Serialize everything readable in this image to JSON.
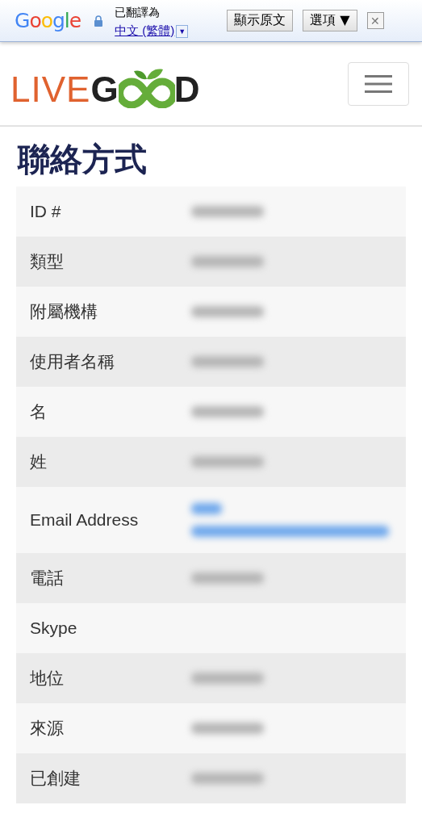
{
  "translate_bar": {
    "brand": "Google",
    "status": "已翻譯為",
    "language": "中文 (繁體)",
    "dropdown": "▼",
    "buttons": [
      "顯示原文",
      "選項 ▼"
    ],
    "close": "✕"
  },
  "header": {
    "logo": {
      "left": "LIVE",
      "middle": "G",
      "right": "D"
    }
  },
  "title": "聯絡方式",
  "rows": [
    {
      "label": "ID #",
      "kind": "redacted"
    },
    {
      "label": "類型",
      "kind": "redacted"
    },
    {
      "label": "附屬機構",
      "kind": "redacted"
    },
    {
      "label": "使用者名稱",
      "kind": "redacted"
    },
    {
      "label": "名",
      "kind": "redacted"
    },
    {
      "label": "姓",
      "kind": "redacted"
    },
    {
      "label": "Email Address",
      "kind": "link"
    },
    {
      "label": "電話",
      "kind": "redacted"
    },
    {
      "label": "Skype"
    },
    {
      "label": "地位",
      "kind": "redacted"
    },
    {
      "label": "來源",
      "kind": "redacted"
    },
    {
      "label": "已創建",
      "kind": "redacted"
    }
  ]
}
